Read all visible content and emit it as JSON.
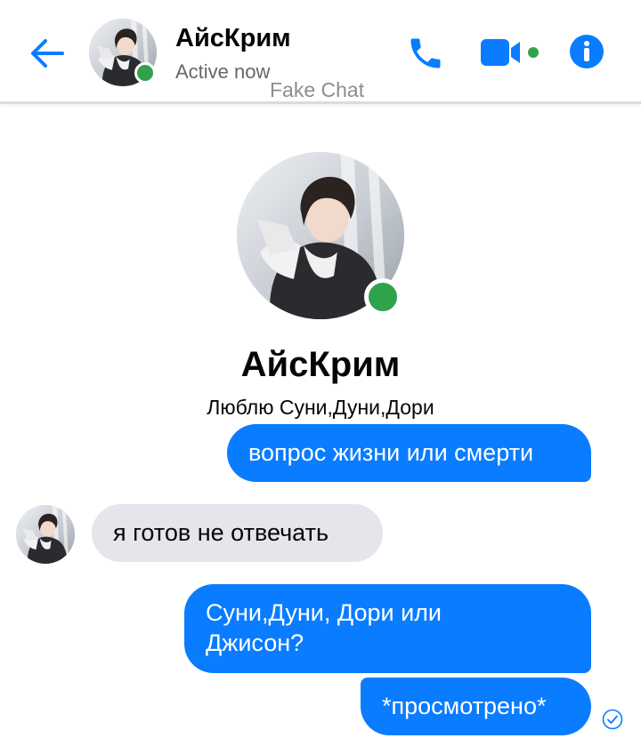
{
  "header": {
    "contact_name": "АйсКрим",
    "status": "Active now",
    "watermark": "Fake Chat",
    "icons": [
      "back-arrow-icon",
      "phone-icon",
      "video-call-icon",
      "info-icon"
    ]
  },
  "profile": {
    "name": "АйсКрим",
    "bio": "Люблю Суни,Дуни,Дори"
  },
  "messages": [
    {
      "side": "out",
      "text": "вопрос жизни или смерти"
    },
    {
      "side": "in",
      "text": "я готов не отвечать"
    },
    {
      "side": "out",
      "lines": [
        "Суни,Дуни, Дори или",
        "Джисон?"
      ]
    },
    {
      "side": "out",
      "text": "*просмотрено*"
    }
  ],
  "colors": {
    "accent": "#0a7cff",
    "online": "#31a24c",
    "incoming_bubble": "#e4e6eb",
    "secondary_text": "#65676b"
  }
}
